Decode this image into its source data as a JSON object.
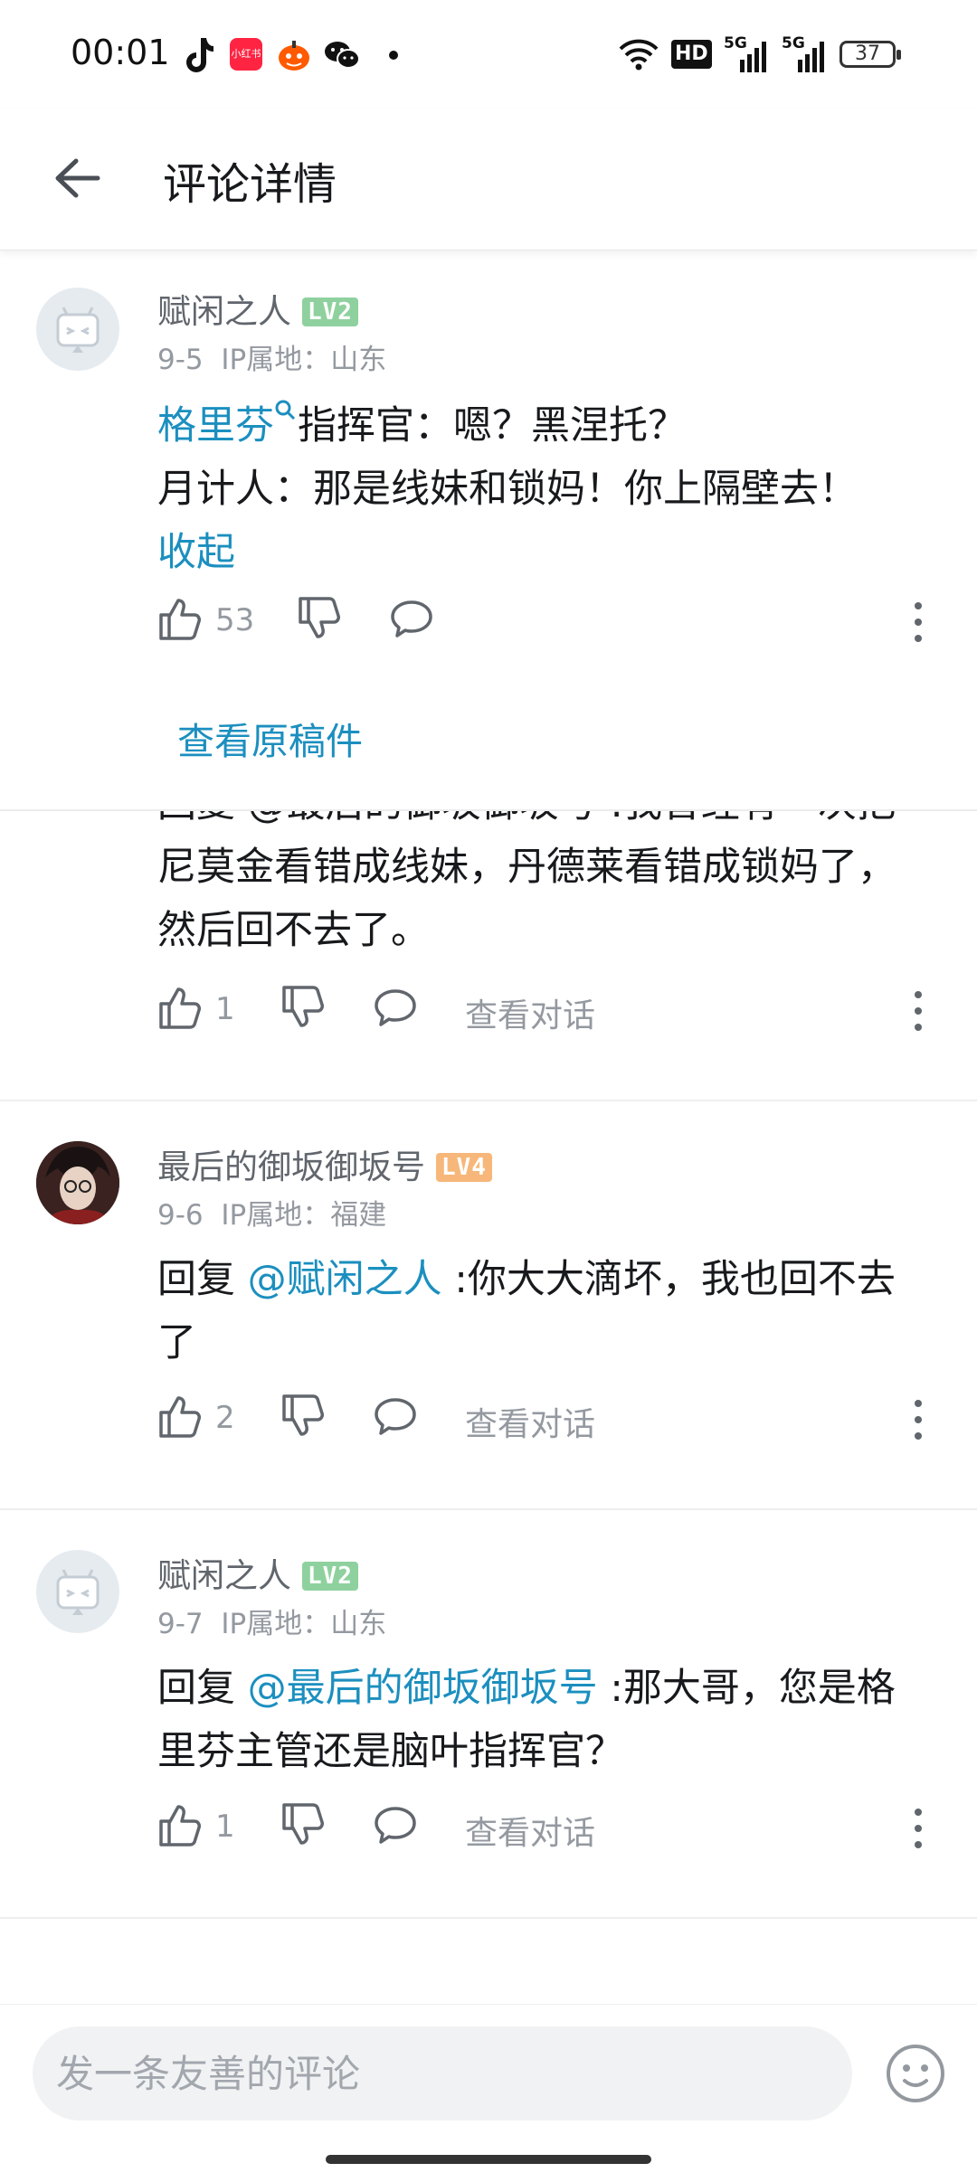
{
  "status_bar": {
    "time": "00:01",
    "network_labels": [
      "HD",
      "5G",
      "5G"
    ],
    "battery": "37",
    "icons": [
      "tiktok-icon",
      "xiaohongshu-icon",
      "taobao-icon",
      "wechat-icon",
      "dot-icon",
      "wifi-icon",
      "hd-icon",
      "signal-5g-icon",
      "signal-5g-icon",
      "battery-icon"
    ],
    "xhs_label": "小红书"
  },
  "header": {
    "title": "评论详情"
  },
  "root_comment": {
    "username": "赋闲之人",
    "level": "LV2",
    "level_color": "#8fd19e",
    "date": "9-5",
    "ip": "IP属地：山东",
    "mention": "格里芬",
    "line1_rest": "指挥官：嗯？黑涅托？",
    "line2": "月计人：那是线妹和锁妈！你上隔壁去！",
    "collapse": "收起",
    "likes": "53",
    "view_original": "查看原稿件"
  },
  "partial_reply": {
    "top_line": "回复 @最后的御坂御坂号 :我曾经有一次把",
    "line2": "尼莫金看错成线妹，丹德莱看错成锁妈了，",
    "line3": "然后回不去了。",
    "likes": "1",
    "view_conversation": "查看对话"
  },
  "replies": [
    {
      "username": "最后的御坂御坂号",
      "level": "LV4",
      "level_color": "#f7b77a",
      "date": "9-6",
      "ip": "IP属地：福建",
      "reply_prefix": "回复 ",
      "mention": "@赋闲之人",
      "text_line1": " :你大大滴坏，我也回不去",
      "text_line2": "了",
      "likes": "2",
      "view_conversation": "查看对话"
    },
    {
      "username": "赋闲之人",
      "level": "LV2",
      "level_color": "#8fd19e",
      "date": "9-7",
      "ip": "IP属地：山东",
      "reply_prefix": "回复 ",
      "mention": "@最后的御坂御坂号",
      "text_line1": " :那大哥，您是格",
      "text_line2": "里芬主管还是脑叶指挥官？",
      "likes": "1",
      "view_conversation": "查看对话"
    }
  ],
  "input_bar": {
    "placeholder": "发一条友善的评论"
  },
  "colors": {
    "link": "#1b8fbf",
    "text": "#18191c",
    "muted": "#9499a0"
  }
}
